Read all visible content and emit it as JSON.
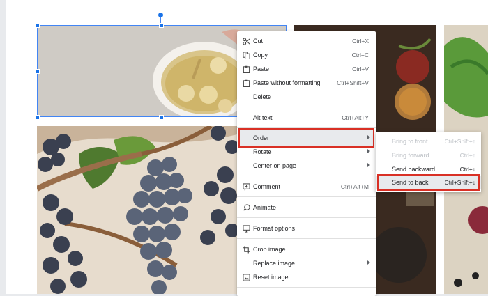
{
  "context_menu": {
    "items": [
      {
        "label": "Cut",
        "shortcut": "Ctrl+X",
        "icon": "scissors-icon"
      },
      {
        "label": "Copy",
        "shortcut": "Ctrl+C",
        "icon": "copy-icon"
      },
      {
        "label": "Paste",
        "shortcut": "Ctrl+V",
        "icon": "clipboard-icon"
      },
      {
        "label": "Paste without formatting",
        "shortcut": "Ctrl+Shift+V",
        "icon": "paste-plain-icon"
      },
      {
        "label": "Delete",
        "shortcut": ""
      },
      {
        "label": "Alt text",
        "shortcut": "Ctrl+Alt+Y"
      },
      {
        "label": "Order",
        "submenu": true
      },
      {
        "label": "Rotate",
        "submenu": true
      },
      {
        "label": "Center on page",
        "submenu": true
      },
      {
        "label": "Comment",
        "shortcut": "Ctrl+Alt+M",
        "icon": "comment-icon"
      },
      {
        "label": "Animate",
        "icon": "animate-icon"
      },
      {
        "label": "Format options",
        "icon": "format-options-icon"
      },
      {
        "label": "Crop image",
        "icon": "crop-icon"
      },
      {
        "label": "Replace image",
        "submenu": true
      },
      {
        "label": "Reset image",
        "icon": "reset-image-icon"
      }
    ]
  },
  "order_submenu": {
    "items": [
      {
        "label": "Bring to front",
        "shortcut": "Ctrl+Shift+↑",
        "enabled": false
      },
      {
        "label": "Bring forward",
        "shortcut": "Ctrl+↑",
        "enabled": false
      },
      {
        "label": "Send backward",
        "shortcut": "Ctrl+↓",
        "enabled": true
      },
      {
        "label": "Send to back",
        "shortcut": "Ctrl+Shift+↓",
        "enabled": true
      }
    ]
  },
  "colors": {
    "selection": "#4285f4",
    "highlight": "#d93025",
    "menu_bg": "#ffffff"
  }
}
